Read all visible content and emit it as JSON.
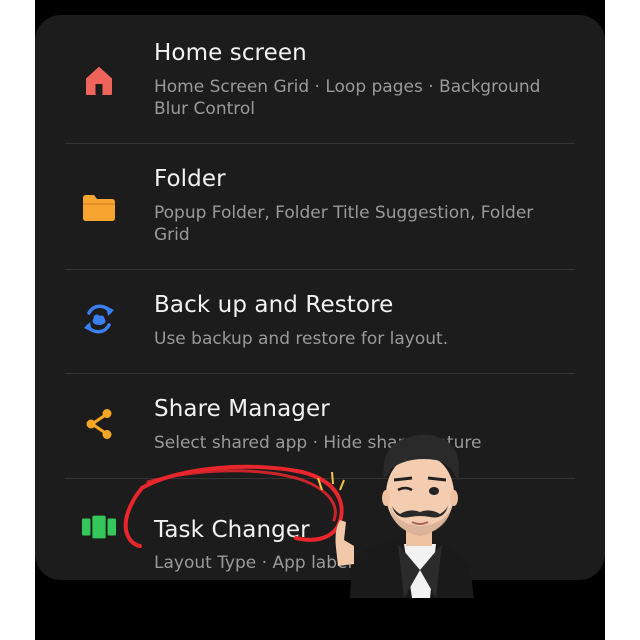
{
  "settings": {
    "items": [
      {
        "title": "Home screen",
        "subtitle": "Home Screen Grid · Loop pages · Background Blur Control",
        "icon": "home-icon",
        "icon_color": "#f0655b"
      },
      {
        "title": "Folder",
        "subtitle": "Popup Folder, Folder Title Suggestion, Folder Grid",
        "icon": "folder-icon",
        "icon_color": "#f8a431"
      },
      {
        "title": "Back up and Restore",
        "subtitle": "Use backup and restore for layout.",
        "icon": "backup-restore-icon",
        "icon_color": "#3a7ef0"
      },
      {
        "title": "Share Manager",
        "subtitle": "Select shared app · Hide share feature",
        "icon": "share-icon",
        "icon_color": "#f5a623"
      },
      {
        "title": "Task Changer",
        "subtitle": "Layout Type · App label",
        "icon": "task-changer-icon",
        "icon_color": "#34c759"
      }
    ]
  },
  "annotation": {
    "highlight_color": "#e8262b"
  }
}
